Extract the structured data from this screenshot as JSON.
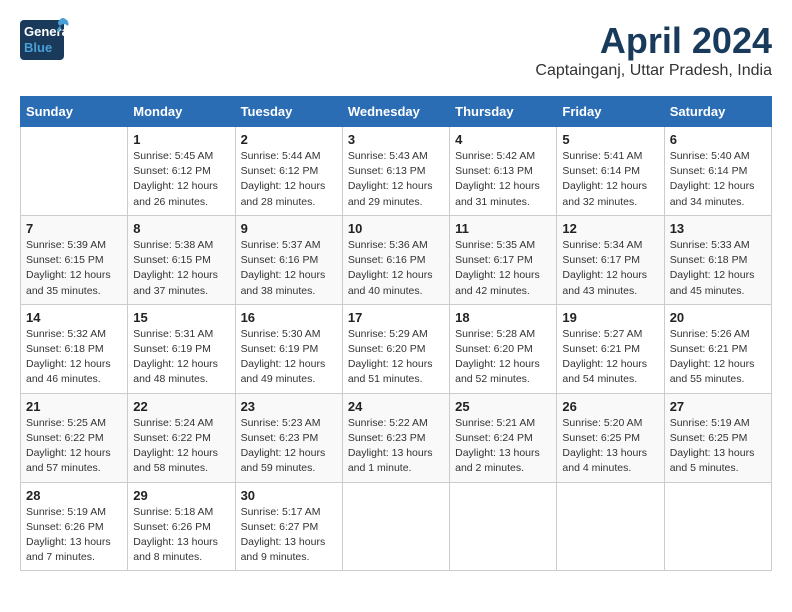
{
  "logo": {
    "line1": "General",
    "line2": "Blue"
  },
  "title": "April 2024",
  "location": "Captainganj, Uttar Pradesh, India",
  "days_of_week": [
    "Sunday",
    "Monday",
    "Tuesday",
    "Wednesday",
    "Thursday",
    "Friday",
    "Saturday"
  ],
  "weeks": [
    [
      {
        "day": "",
        "info": ""
      },
      {
        "day": "1",
        "info": "Sunrise: 5:45 AM\nSunset: 6:12 PM\nDaylight: 12 hours\nand 26 minutes."
      },
      {
        "day": "2",
        "info": "Sunrise: 5:44 AM\nSunset: 6:12 PM\nDaylight: 12 hours\nand 28 minutes."
      },
      {
        "day": "3",
        "info": "Sunrise: 5:43 AM\nSunset: 6:13 PM\nDaylight: 12 hours\nand 29 minutes."
      },
      {
        "day": "4",
        "info": "Sunrise: 5:42 AM\nSunset: 6:13 PM\nDaylight: 12 hours\nand 31 minutes."
      },
      {
        "day": "5",
        "info": "Sunrise: 5:41 AM\nSunset: 6:14 PM\nDaylight: 12 hours\nand 32 minutes."
      },
      {
        "day": "6",
        "info": "Sunrise: 5:40 AM\nSunset: 6:14 PM\nDaylight: 12 hours\nand 34 minutes."
      }
    ],
    [
      {
        "day": "7",
        "info": "Sunrise: 5:39 AM\nSunset: 6:15 PM\nDaylight: 12 hours\nand 35 minutes."
      },
      {
        "day": "8",
        "info": "Sunrise: 5:38 AM\nSunset: 6:15 PM\nDaylight: 12 hours\nand 37 minutes."
      },
      {
        "day": "9",
        "info": "Sunrise: 5:37 AM\nSunset: 6:16 PM\nDaylight: 12 hours\nand 38 minutes."
      },
      {
        "day": "10",
        "info": "Sunrise: 5:36 AM\nSunset: 6:16 PM\nDaylight: 12 hours\nand 40 minutes."
      },
      {
        "day": "11",
        "info": "Sunrise: 5:35 AM\nSunset: 6:17 PM\nDaylight: 12 hours\nand 42 minutes."
      },
      {
        "day": "12",
        "info": "Sunrise: 5:34 AM\nSunset: 6:17 PM\nDaylight: 12 hours\nand 43 minutes."
      },
      {
        "day": "13",
        "info": "Sunrise: 5:33 AM\nSunset: 6:18 PM\nDaylight: 12 hours\nand 45 minutes."
      }
    ],
    [
      {
        "day": "14",
        "info": "Sunrise: 5:32 AM\nSunset: 6:18 PM\nDaylight: 12 hours\nand 46 minutes."
      },
      {
        "day": "15",
        "info": "Sunrise: 5:31 AM\nSunset: 6:19 PM\nDaylight: 12 hours\nand 48 minutes."
      },
      {
        "day": "16",
        "info": "Sunrise: 5:30 AM\nSunset: 6:19 PM\nDaylight: 12 hours\nand 49 minutes."
      },
      {
        "day": "17",
        "info": "Sunrise: 5:29 AM\nSunset: 6:20 PM\nDaylight: 12 hours\nand 51 minutes."
      },
      {
        "day": "18",
        "info": "Sunrise: 5:28 AM\nSunset: 6:20 PM\nDaylight: 12 hours\nand 52 minutes."
      },
      {
        "day": "19",
        "info": "Sunrise: 5:27 AM\nSunset: 6:21 PM\nDaylight: 12 hours\nand 54 minutes."
      },
      {
        "day": "20",
        "info": "Sunrise: 5:26 AM\nSunset: 6:21 PM\nDaylight: 12 hours\nand 55 minutes."
      }
    ],
    [
      {
        "day": "21",
        "info": "Sunrise: 5:25 AM\nSunset: 6:22 PM\nDaylight: 12 hours\nand 57 minutes."
      },
      {
        "day": "22",
        "info": "Sunrise: 5:24 AM\nSunset: 6:22 PM\nDaylight: 12 hours\nand 58 minutes."
      },
      {
        "day": "23",
        "info": "Sunrise: 5:23 AM\nSunset: 6:23 PM\nDaylight: 12 hours\nand 59 minutes."
      },
      {
        "day": "24",
        "info": "Sunrise: 5:22 AM\nSunset: 6:23 PM\nDaylight: 13 hours\nand 1 minute."
      },
      {
        "day": "25",
        "info": "Sunrise: 5:21 AM\nSunset: 6:24 PM\nDaylight: 13 hours\nand 2 minutes."
      },
      {
        "day": "26",
        "info": "Sunrise: 5:20 AM\nSunset: 6:25 PM\nDaylight: 13 hours\nand 4 minutes."
      },
      {
        "day": "27",
        "info": "Sunrise: 5:19 AM\nSunset: 6:25 PM\nDaylight: 13 hours\nand 5 minutes."
      }
    ],
    [
      {
        "day": "28",
        "info": "Sunrise: 5:19 AM\nSunset: 6:26 PM\nDaylight: 13 hours\nand 7 minutes."
      },
      {
        "day": "29",
        "info": "Sunrise: 5:18 AM\nSunset: 6:26 PM\nDaylight: 13 hours\nand 8 minutes."
      },
      {
        "day": "30",
        "info": "Sunrise: 5:17 AM\nSunset: 6:27 PM\nDaylight: 13 hours\nand 9 minutes."
      },
      {
        "day": "",
        "info": ""
      },
      {
        "day": "",
        "info": ""
      },
      {
        "day": "",
        "info": ""
      },
      {
        "day": "",
        "info": ""
      }
    ]
  ]
}
